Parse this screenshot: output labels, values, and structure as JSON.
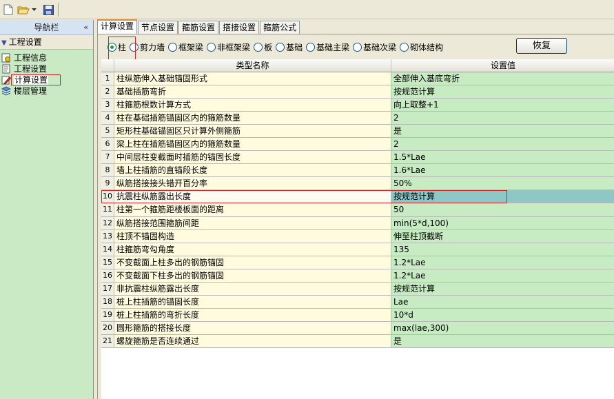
{
  "nav": {
    "title": "导航栏",
    "collapse_glyph": "«",
    "group_label": "工程设置",
    "items": [
      {
        "label": "工程信息",
        "icon": "info-doc-icon",
        "selected": false
      },
      {
        "label": "工程设置",
        "icon": "settings-doc-icon",
        "selected": false
      },
      {
        "label": "计算设置",
        "icon": "calc-edit-icon",
        "selected": true
      },
      {
        "label": "楼层管理",
        "icon": "floor-stack-icon",
        "selected": false
      }
    ]
  },
  "tabs": [
    {
      "label": "计算设置",
      "active": true
    },
    {
      "label": "节点设置",
      "active": false
    },
    {
      "label": "箍筋设置",
      "active": false
    },
    {
      "label": "搭接设置",
      "active": false
    },
    {
      "label": "箍筋公式",
      "active": false
    }
  ],
  "component_types": [
    {
      "label": "柱",
      "checked": true
    },
    {
      "label": "剪力墙",
      "checked": false
    },
    {
      "label": "框架梁",
      "checked": false
    },
    {
      "label": "非框架梁",
      "checked": false
    },
    {
      "label": "板",
      "checked": false
    },
    {
      "label": "基础",
      "checked": false
    },
    {
      "label": "基础主梁",
      "checked": false
    },
    {
      "label": "基础次梁",
      "checked": false
    },
    {
      "label": "砌体结构",
      "checked": false
    }
  ],
  "restore_label": "恢复",
  "grid": {
    "col_name": "类型名称",
    "col_value": "设置值",
    "selected_row": 10,
    "rows": [
      {
        "n": "1",
        "name": "柱纵筋伸入基础锚固形式",
        "value": "全部伸入基底弯折"
      },
      {
        "n": "2",
        "name": "基础插筋弯折",
        "value": "按规范计算"
      },
      {
        "n": "3",
        "name": "柱箍筋根数计算方式",
        "value": "向上取整+1"
      },
      {
        "n": "4",
        "name": "柱在基础插筋锚固区内的箍筋数量",
        "value": "2"
      },
      {
        "n": "5",
        "name": "矩形柱基础锚固区只计算外侧箍筋",
        "value": "是"
      },
      {
        "n": "6",
        "name": "梁上柱在插筋锚固区内的箍筋数量",
        "value": "2"
      },
      {
        "n": "7",
        "name": "中间层柱变截面时插筋的锚固长度",
        "value": "1.5*Lae"
      },
      {
        "n": "8",
        "name": "墙上柱插筋的直锚段长度",
        "value": "1.6*Lae"
      },
      {
        "n": "9",
        "name": "纵筋搭接接头错开百分率",
        "value": "50%"
      },
      {
        "n": "10",
        "name": "抗震柱纵筋露出长度",
        "value": "按规范计算"
      },
      {
        "n": "11",
        "name": "柱第一个箍筋距楼板面的距离",
        "value": "50"
      },
      {
        "n": "12",
        "name": "纵筋搭接范围箍筋间距",
        "value": "min(5*d,100)"
      },
      {
        "n": "13",
        "name": "柱顶不锚固构造",
        "value": "伸至柱顶截断"
      },
      {
        "n": "14",
        "name": "柱箍筋弯勾角度",
        "value": "135"
      },
      {
        "n": "15",
        "name": "不变截面上柱多出的钢筋锚固",
        "value": "1.2*Lae"
      },
      {
        "n": "16",
        "name": "不变截面下柱多出的钢筋锚固",
        "value": "1.2*Lae"
      },
      {
        "n": "17",
        "name": "非抗震柱纵筋露出长度",
        "value": "按规范计算"
      },
      {
        "n": "18",
        "name": "桩上柱插筋的锚固长度",
        "value": "Lae"
      },
      {
        "n": "19",
        "name": "桩上柱插筋的弯折长度",
        "value": "10*d"
      },
      {
        "n": "20",
        "name": "圆形箍筋的搭接长度",
        "value": "max(lae,300)"
      },
      {
        "n": "21",
        "name": "螺旋箍筋是否连续通过",
        "value": "是"
      }
    ]
  }
}
